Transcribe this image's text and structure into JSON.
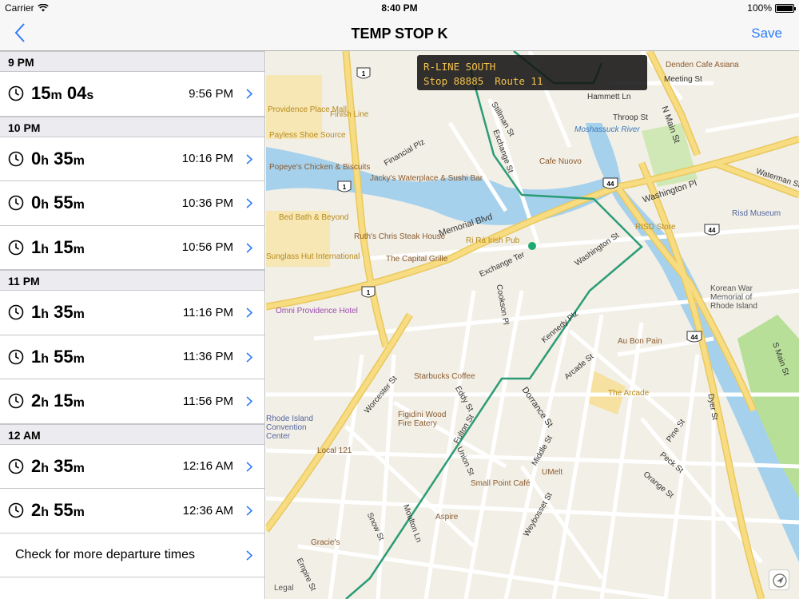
{
  "status_bar": {
    "carrier": "Carrier",
    "time": "8:40 PM",
    "battery": "100%"
  },
  "nav": {
    "title": "TEMP STOP K",
    "save_label": "Save"
  },
  "table": {
    "sections": [
      {
        "header": "9 PM",
        "rows": [
          {
            "h": "15",
            "hu": "m",
            "m": "04",
            "mu": "s",
            "time": "9:56 PM"
          }
        ]
      },
      {
        "header": "10 PM",
        "rows": [
          {
            "h": "0",
            "hu": "h",
            "m": "35",
            "mu": "m",
            "time": "10:16 PM"
          },
          {
            "h": "0",
            "hu": "h",
            "m": "55",
            "mu": "m",
            "time": "10:36 PM"
          },
          {
            "h": "1",
            "hu": "h",
            "m": "15",
            "mu": "m",
            "time": "10:56 PM"
          }
        ]
      },
      {
        "header": "11 PM",
        "rows": [
          {
            "h": "1",
            "hu": "h",
            "m": "35",
            "mu": "m",
            "time": "11:16 PM"
          },
          {
            "h": "1",
            "hu": "h",
            "m": "55",
            "mu": "m",
            "time": "11:36 PM"
          },
          {
            "h": "2",
            "hu": "h",
            "m": "15",
            "mu": "m",
            "time": "11:56 PM"
          }
        ]
      },
      {
        "header": "12 AM",
        "rows": [
          {
            "h": "2",
            "hu": "h",
            "m": "35",
            "mu": "m",
            "time": "12:16 AM"
          },
          {
            "h": "2",
            "hu": "h",
            "m": "55",
            "mu": "m",
            "time": "12:36 AM"
          }
        ]
      }
    ],
    "more_label": "Check for more departure times"
  },
  "map": {
    "callout": {
      "line1": "R-LINE SOUTH",
      "stop": "Stop 88885",
      "route": "Route 11"
    },
    "places": [
      "Providence Place Mall",
      "Finish Line",
      "Payless Shoe Source",
      "Popeye's Chicken & Biscuits",
      "Jacky's Waterplace & Sushi Bar",
      "Bed Bath & Beyond",
      "Ruth's Chris Steak House",
      "Ri Rá Irish Pub",
      "The Capital Grille",
      "Sunglass Hut International",
      "Omni Providence Hotel",
      "Cafe Nuovo",
      "Moshassuck River",
      "RISD Store",
      "Risd Museum",
      "Korean War Memorial of Rhode Island",
      "Au Bon Pain",
      "The Arcade",
      "Starbucks Coffee",
      "Figidini Wood Fire Eatery",
      "Local 121",
      "UMelt",
      "Small Point Café",
      "Aspire",
      "Gracie's",
      "Rhode Island Convention Center",
      "Denden Cafe Asiana",
      "Meeting St",
      "Hammett Ln",
      "Throop St"
    ],
    "streets": [
      "Memorial Blvd",
      "Exchange Ter",
      "Washington Pl",
      "Washington St",
      "Cookson Pl",
      "Kennedy Plz",
      "Arcade St",
      "Dorrance St",
      "Worcester St",
      "Eddy St",
      "Fulton St",
      "Union St",
      "Middle St",
      "Weybosset St",
      "Snow St",
      "Moulton Ln",
      "Empire St",
      "Pine St",
      "Peck St",
      "Orange St",
      "Dyer St",
      "N Main St",
      "S Main St",
      "Waterman St",
      "Financial Plz",
      "Stillman St",
      "Exchange St"
    ],
    "shields": [
      "1",
      "1",
      "1",
      "44",
      "44",
      "44"
    ],
    "legal_label": "Legal",
    "colors": {
      "route": "#2c9c77",
      "highway": "#f5d46c",
      "water": "#a6d1ec",
      "park": "#b7df98"
    }
  }
}
